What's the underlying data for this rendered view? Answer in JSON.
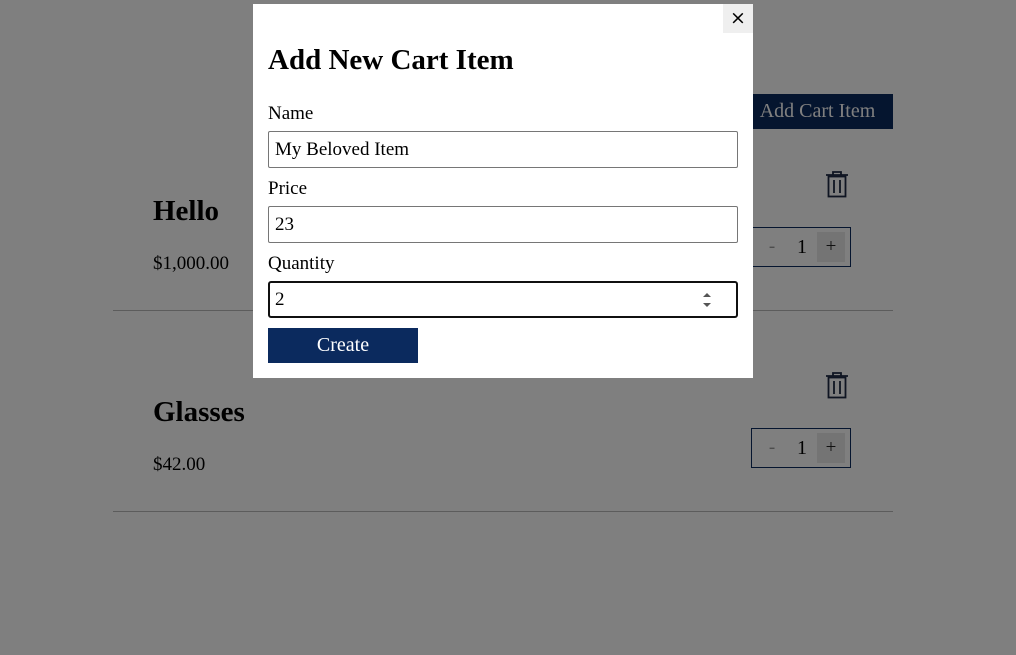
{
  "header": {
    "add_cart_item_label": "Add Cart Item"
  },
  "cart_items": [
    {
      "name": "Hello",
      "price": "$1,000.00",
      "quantity": "1",
      "minus_label": "-",
      "plus_label": "+"
    },
    {
      "name": "Glasses",
      "price": "$42.00",
      "quantity": "1",
      "minus_label": "-",
      "plus_label": "+"
    }
  ],
  "modal": {
    "title": "Add New Cart Item",
    "close_label": "×",
    "fields": {
      "name": {
        "label": "Name",
        "value": "My Beloved Item"
      },
      "price": {
        "label": "Price",
        "value": "23"
      },
      "quantity": {
        "label": "Quantity",
        "value": "2"
      }
    },
    "submit_label": "Create"
  },
  "colors": {
    "brand": "#0b2a5e",
    "overlay": "rgba(0,0,0,0.5)"
  },
  "icons": {
    "delete": "trash-icon",
    "close": "close-icon"
  }
}
